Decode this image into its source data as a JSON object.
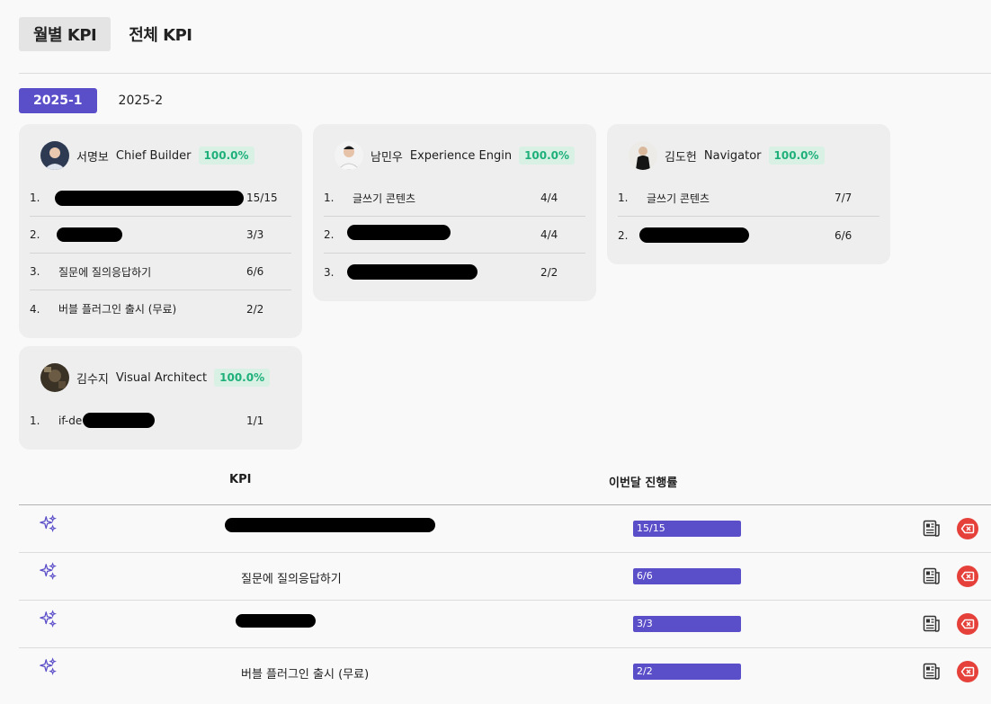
{
  "main_tabs": [
    {
      "label": "월별 KPI",
      "active": true
    },
    {
      "label": "전체 KPI",
      "active": false
    }
  ],
  "period_tabs": [
    {
      "label": "2025-1",
      "active": true
    },
    {
      "label": "2025-2",
      "active": false
    }
  ],
  "members": [
    {
      "name": "서명보",
      "role": "Chief Builder",
      "percent": "100.0%",
      "kpis": [
        {
          "num": "1.",
          "name": "",
          "count": "15/15"
        },
        {
          "num": "2.",
          "name": "",
          "count": "3/3"
        },
        {
          "num": "3.",
          "name": "질문에 질의응답하기",
          "count": "6/6"
        },
        {
          "num": "4.",
          "name": "버블 플러그인 출시 (무료)",
          "count": "2/2"
        }
      ]
    },
    {
      "name": "남민우",
      "role": "Experience Engin",
      "percent": "100.0%",
      "kpis": [
        {
          "num": "1.",
          "name": "글쓰기 콘텐츠",
          "count": "4/4"
        },
        {
          "num": "2.",
          "name": "",
          "count": "4/4"
        },
        {
          "num": "3.",
          "name": "",
          "count": "2/2"
        }
      ]
    },
    {
      "name": "김도헌",
      "role": "Navigator",
      "percent": "100.0%",
      "kpis": [
        {
          "num": "1.",
          "name": "글쓰기 콘텐츠",
          "count": "7/7"
        },
        {
          "num": "2.",
          "name": "",
          "count": "6/6"
        }
      ]
    },
    {
      "name": "김수지",
      "role": "Visual Architect",
      "percent": "100.0%",
      "kpis": [
        {
          "num": "1.",
          "name": "if-de",
          "count": "1/1"
        }
      ]
    }
  ],
  "table": {
    "headers": {
      "kpi": "KPI",
      "progress": "이번달 진행률"
    },
    "rows": [
      {
        "kpi": "",
        "progress_label": "15/15",
        "progress": 1.0
      },
      {
        "kpi": "질문에 질의응답하기",
        "progress_label": "6/6",
        "progress": 1.0
      },
      {
        "kpi": "",
        "progress_label": "3/3",
        "progress": 1.0
      },
      {
        "kpi": "버블 플러그인 출시 (무료)",
        "progress_label": "2/2",
        "progress": 1.0
      }
    ]
  },
  "colors": {
    "accent": "#5b4fc9",
    "success": "#1fb07a",
    "danger": "#e5413a"
  },
  "icons": {
    "row_icon": "sparkle-icon",
    "detail_icon": "document-icon",
    "delete_icon": "delete-icon"
  }
}
